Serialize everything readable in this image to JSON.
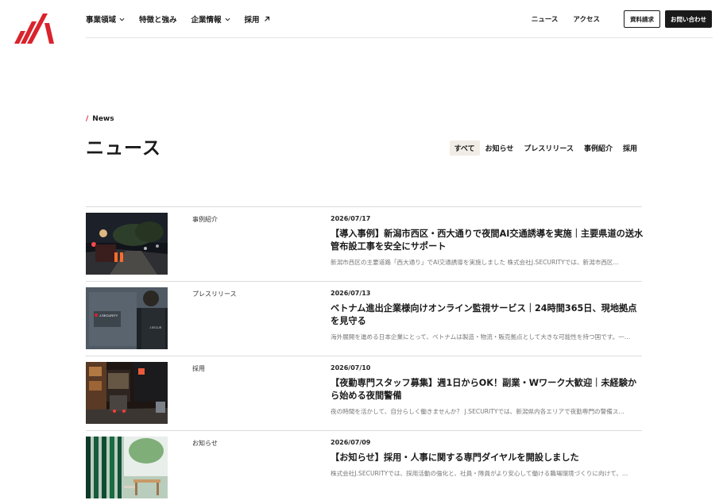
{
  "header": {
    "nav": [
      {
        "label": "事業領域",
        "has_dropdown": true
      },
      {
        "label": "特徴と強み",
        "has_dropdown": false
      },
      {
        "label": "企業情報",
        "has_dropdown": true
      },
      {
        "label": "採用",
        "external": true
      }
    ],
    "links": [
      "ニュース",
      "アクセス"
    ],
    "buttons": {
      "materials": "資料請求",
      "contact": "お問い合わせ"
    }
  },
  "page": {
    "eyebrow_slash": "/",
    "eyebrow": "News",
    "title": "ニュース"
  },
  "tabs": [
    {
      "label": "すべて",
      "active": true
    },
    {
      "label": "お知らせ",
      "active": false
    },
    {
      "label": "プレスリリース",
      "active": false
    },
    {
      "label": "事例紹介",
      "active": false
    },
    {
      "label": "採用",
      "active": false
    }
  ],
  "articles": [
    {
      "category": "事例紹介",
      "date": "2026/07/17",
      "title": "【導入事例】新潟市西区・西大通りで夜間AI交通誘導を実施｜主要県道の送水管布設工事を安全にサポート",
      "excerpt": "新潟市西区の主要道路「西大通り」でAI交通誘導を実施しました 株式会社J.SECURITYでは、新潟市西区...",
      "thumb": "night-road-construction"
    },
    {
      "category": "プレスリリース",
      "date": "2026/07/13",
      "title": "ベトナム進出企業様向けオンライン監視サービス｜24時間365日、現地拠点を見守る",
      "excerpt": "海外展開を進める日本企業にとって、ベトナムは製造・物流・販売拠点として大きな可能性を持つ国です。一...",
      "thumb": "security-monitoring",
      "thumb_text": {
        "brand": "J.SECURITY",
        "badge": "J.SECUR"
      }
    },
    {
      "category": "採用",
      "date": "2026/07/10",
      "title": "【夜勤専門スタッフ募集】週1日からOK！副業・Wワーク大歓迎｜未経験から始める夜間警備",
      "excerpt": "夜の時間を活かして、自分らしく働きませんか？ J.SECURITYでは、新潟県内各エリアで夜勤専門の警備ス...",
      "thumb": "night-city-street"
    },
    {
      "category": "お知らせ",
      "date": "2026/07/09",
      "title": "【お知らせ】採用・人事に関する専門ダイヤルを開設しました",
      "excerpt": "株式会社J.SECURITYでは、採用活動の強化と、社員・隊員がより安心して働ける職場環境づくりに向けて、...",
      "thumb": "green-office"
    }
  ],
  "colors": {
    "accent": "#d9232d",
    "text": "#1a1a1a",
    "muted": "#777777",
    "tab_active_bg": "#f1ede6"
  }
}
